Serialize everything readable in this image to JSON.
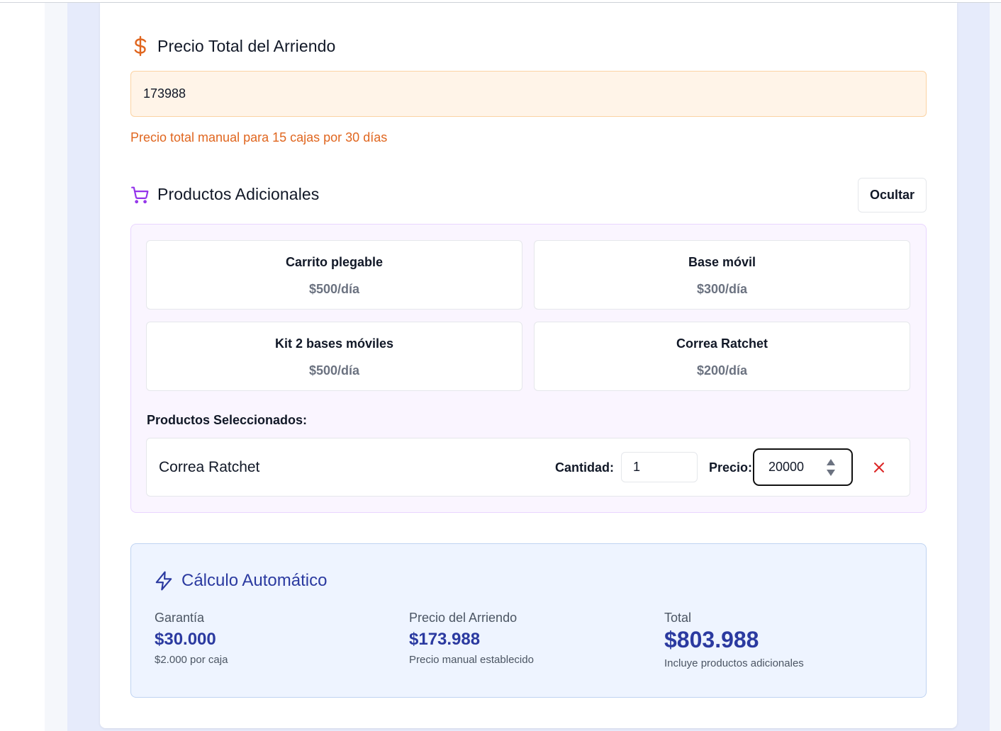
{
  "colors": {
    "accent_orange": "#e0661f",
    "accent_purple": "#9333ea",
    "accent_blue": "#2b3aa0",
    "danger": "#dc2626"
  },
  "price_section": {
    "icon": "dollar-icon",
    "title": "Precio Total del Arriendo",
    "input_value": "173988",
    "hint": "Precio total manual para 15 cajas por 30 días"
  },
  "products_section": {
    "icon": "cart-icon",
    "title": "Productos Adicionales",
    "toggle_label": "Ocultar",
    "products": [
      {
        "name": "Carrito plegable",
        "price": "$500/día"
      },
      {
        "name": "Base móvil",
        "price": "$300/día"
      },
      {
        "name": "Kit 2 bases móviles",
        "price": "$500/día"
      },
      {
        "name": "Correa Ratchet",
        "price": "$200/día"
      }
    ],
    "selected_label": "Productos Seleccionados:",
    "selected": [
      {
        "name": "Correa Ratchet",
        "qty_label": "Cantidad:",
        "qty_value": "1",
        "price_label": "Precio:",
        "price_value": "20000",
        "remove_icon": "close-icon"
      }
    ]
  },
  "calc_section": {
    "icon": "lightning-icon",
    "title": "Cálculo Automático",
    "garantia": {
      "label": "Garantía",
      "value": "$30.000",
      "note": "$2.000 por caja"
    },
    "arriendo": {
      "label": "Precio del Arriendo",
      "value": "$173.988",
      "note": "Precio manual establecido"
    },
    "total": {
      "label": "Total",
      "value": "$803.988",
      "note": "Incluye productos adicionales"
    }
  }
}
